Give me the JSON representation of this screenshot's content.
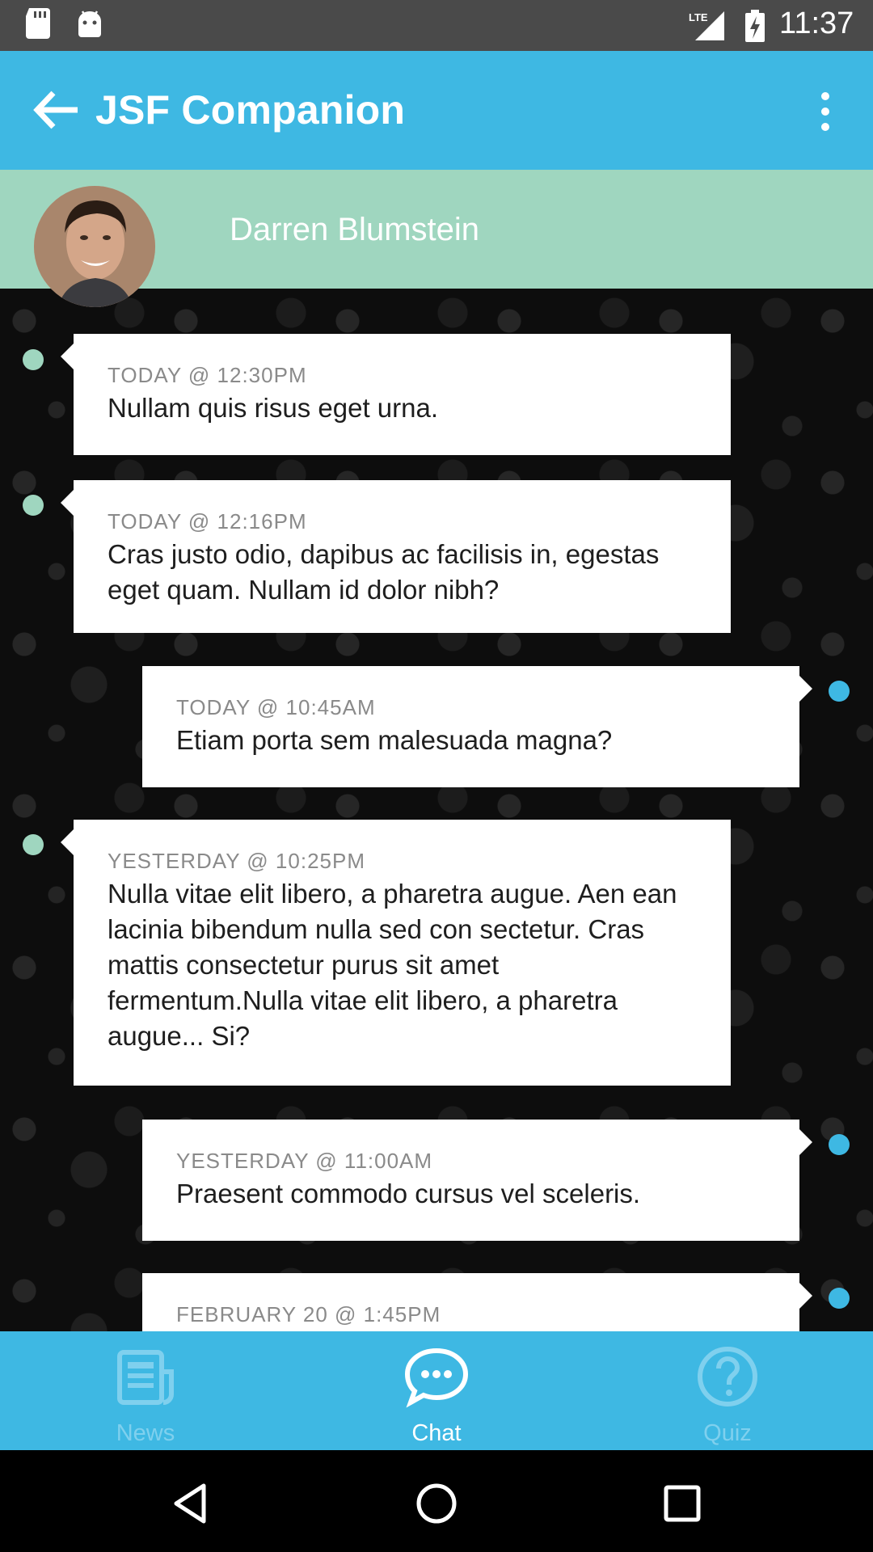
{
  "status_bar": {
    "time": "11:37",
    "network_label": "LTE",
    "icons": [
      "sd-card-icon",
      "android-icon",
      "lte-signal-icon",
      "battery-charging-icon"
    ]
  },
  "app_bar": {
    "title": "JSF Companion",
    "back_icon": "arrow-left-icon",
    "menu_icon": "more-vertical-icon"
  },
  "contact": {
    "name": "Darren Blumstein",
    "avatar_icon": "avatar-photo"
  },
  "messages": [
    {
      "time": "TODAY @ 12:30PM",
      "text": "Nullam quis risus eget urna.",
      "direction": "in"
    },
    {
      "time": "TODAY @ 12:16PM",
      "text": "Cras justo odio, dapibus ac facilisis in, egestas eget quam. Nullam id dolor nibh?",
      "direction": "in"
    },
    {
      "time": "TODAY @ 10:45AM",
      "text": "Etiam porta sem malesuada magna?",
      "direction": "out"
    },
    {
      "time": "YESTERDAY @ 10:25PM",
      "text": "Nulla vitae elit libero, a pharetra augue. Aen ean lacinia bibendum nulla sed con sectetur. Cras mattis consectetur purus sit amet fermentum.Nulla vitae elit libero, a pharetra augue... Si?",
      "direction": "in"
    },
    {
      "time": "YESTERDAY @ 11:00AM",
      "text": "Praesent commodo cursus vel sceleris.",
      "direction": "out"
    },
    {
      "time": "FEBRUARY 20 @ 1:45PM",
      "text": "",
      "direction": "out"
    }
  ],
  "bottom_nav": {
    "items": [
      {
        "label": "News",
        "icon": "newspaper-icon",
        "active": false
      },
      {
        "label": "Chat",
        "icon": "chat-bubble-icon",
        "active": true
      },
      {
        "label": "Quiz",
        "icon": "question-circle-icon",
        "active": false
      }
    ]
  },
  "colors": {
    "primary": "#3eb8e3",
    "contact_header": "#9fd6bf",
    "incoming_dot": "#9fd6bf",
    "outgoing_dot": "#3eb8e3",
    "nav_inactive": "#7fd0ee"
  }
}
